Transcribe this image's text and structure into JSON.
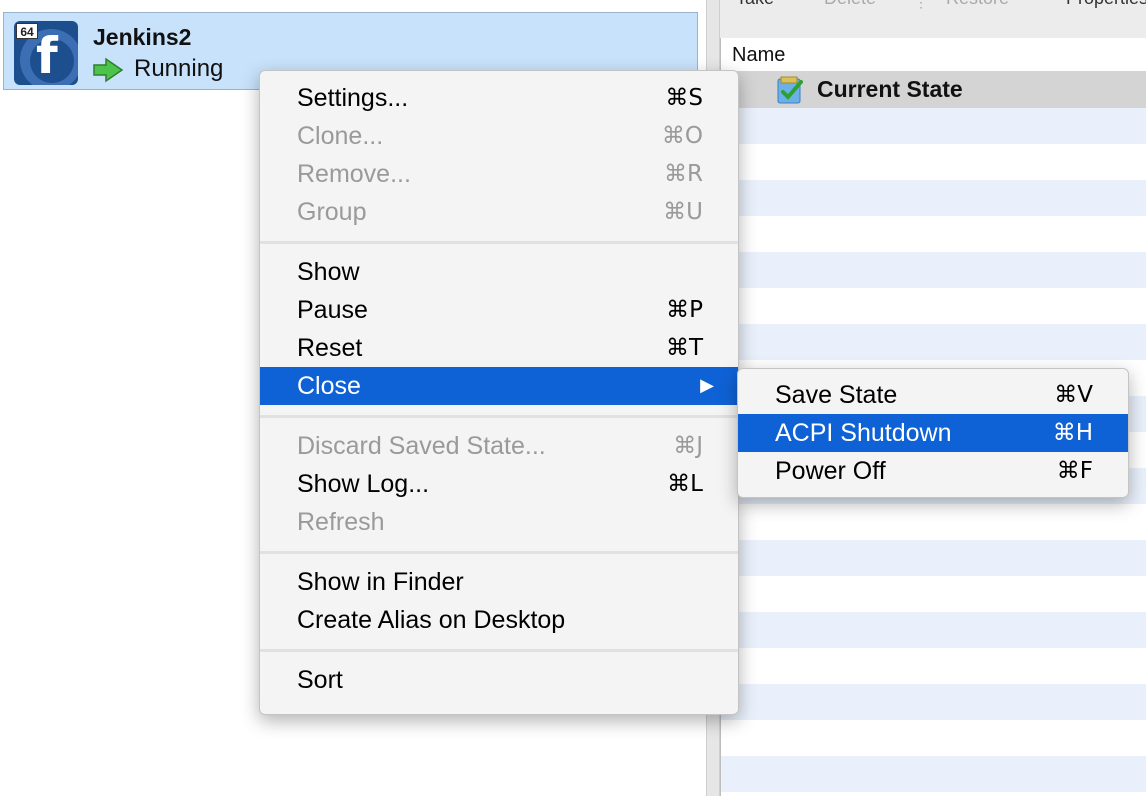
{
  "vm": {
    "badge": "64",
    "name": "Jenkins2",
    "status": "Running"
  },
  "toolbar": {
    "take": "Take",
    "delete": "Delete",
    "separator": "⋮",
    "restore": "Restore",
    "properties": "Properties"
  },
  "snapshots": {
    "column_header": "Name",
    "current_state": "Current State"
  },
  "context_menu": {
    "settings": {
      "label": "Settings...",
      "shortcut": "⌘S"
    },
    "clone": {
      "label": "Clone...",
      "shortcut": "⌘O"
    },
    "remove": {
      "label": "Remove...",
      "shortcut": "⌘R"
    },
    "group": {
      "label": "Group",
      "shortcut": "⌘U"
    },
    "show": {
      "label": "Show"
    },
    "pause": {
      "label": "Pause",
      "shortcut": "⌘P"
    },
    "reset": {
      "label": "Reset",
      "shortcut": "⌘T"
    },
    "close": {
      "label": "Close",
      "arrow": "▶"
    },
    "discard": {
      "label": "Discard Saved State...",
      "shortcut": "⌘J"
    },
    "show_log": {
      "label": "Show Log...",
      "shortcut": "⌘L"
    },
    "refresh": {
      "label": "Refresh"
    },
    "show_in_finder": {
      "label": "Show in Finder"
    },
    "create_alias": {
      "label": "Create Alias on Desktop"
    },
    "sort": {
      "label": "Sort"
    }
  },
  "close_submenu": {
    "save_state": {
      "label": "Save State",
      "shortcut": "⌘V"
    },
    "acpi_shutdown": {
      "label": "ACPI Shutdown",
      "shortcut": "⌘H"
    },
    "power_off": {
      "label": "Power Off",
      "shortcut": "⌘F"
    }
  },
  "colors": {
    "selection": "#0f62d6",
    "vm_item_bg": "#c8e2fb",
    "stripe": "#e9f0fb",
    "disabled_text": "#9a9a9a"
  },
  "icons": {
    "vm_os": "fedora-icon",
    "status": "running-arrow-icon",
    "snapshot": "current-state-icon"
  }
}
